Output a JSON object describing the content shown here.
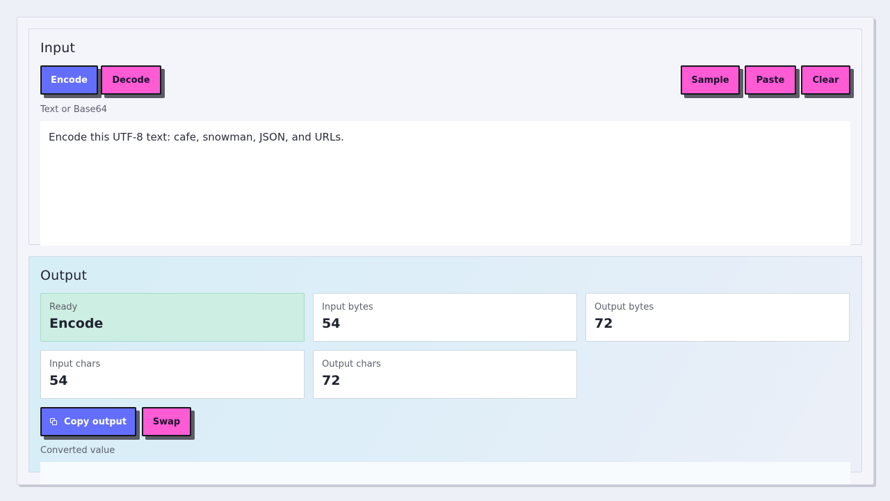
{
  "input": {
    "title": "Input",
    "encode_label": "Encode",
    "decode_label": "Decode",
    "sample_label": "Sample",
    "paste_label": "Paste",
    "clear_label": "Clear",
    "field_label": "Text or Base64",
    "text_value": "Encode this UTF-8 text: cafe, snowman, JSON, and URLs."
  },
  "output": {
    "title": "Output",
    "stats": {
      "status": {
        "label": "Ready",
        "value": "Encode"
      },
      "input_bytes": {
        "label": "Input bytes",
        "value": "54"
      },
      "output_bytes": {
        "label": "Output bytes",
        "value": "72"
      },
      "input_chars": {
        "label": "Input chars",
        "value": "54"
      },
      "output_chars": {
        "label": "Output chars",
        "value": "72"
      }
    },
    "copy_label": "Copy output",
    "swap_label": "Swap",
    "field_label": "Converted value",
    "converted_value": ""
  },
  "colors": {
    "primary": "#646efc",
    "pink": "#ff5bd5",
    "ready": "#cdeee2"
  },
  "icons": {
    "copy": "copy-icon"
  }
}
